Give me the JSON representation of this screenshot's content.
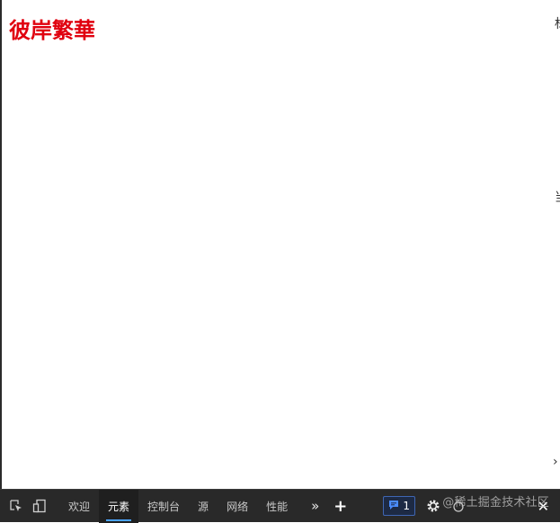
{
  "page": {
    "heading": "彼岸繁華",
    "heading_color": "#e0000f",
    "right_edge_top": "标",
    "right_edge_mid": "当",
    "right_edge_chevron": "›"
  },
  "devtools": {
    "icons": {
      "inspect": "inspect-element-icon",
      "device": "device-toolbar-icon",
      "more": "more-tabs-icon",
      "add": "add-tab-icon",
      "issues": "issues-icon",
      "settings": "gear-icon",
      "feedback": "feedback-icon",
      "close": "close-icon"
    },
    "tabs": [
      {
        "label": "欢迎",
        "active": false
      },
      {
        "label": "元素",
        "active": true
      },
      {
        "label": "控制台",
        "active": false
      },
      {
        "label": "源",
        "active": false
      },
      {
        "label": "网络",
        "active": false
      },
      {
        "label": "性能",
        "active": false
      }
    ],
    "more_symbol": "»",
    "add_symbol": "+",
    "issues_count": "1",
    "close_symbol": "✕",
    "accent_color": "#4aa3ff"
  },
  "watermark": "@稀土掘金技术社区"
}
